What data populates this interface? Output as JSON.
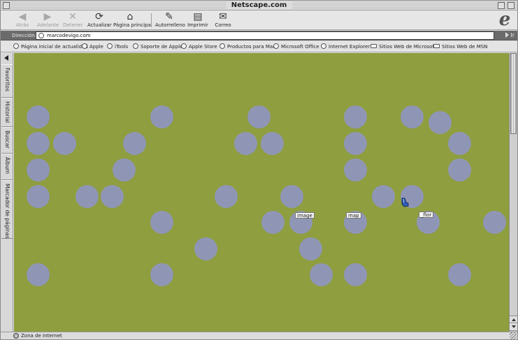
{
  "window": {
    "title": "Netscape.com"
  },
  "toolbar": {
    "back": "Atrás",
    "forward": "Adelante",
    "stop": "Detener",
    "refresh": "Actualizar",
    "home": "Página principal",
    "autofill": "Autorrelleno",
    "print": "Imprimir",
    "mail": "Correo",
    "logo": "e"
  },
  "address": {
    "label": "Dirección:",
    "value": "marcodevigo.com",
    "go": "Ir"
  },
  "favorites": [
    {
      "label": "Página inicial de actualidad",
      "icon": "globe-icon"
    },
    {
      "label": "Apple",
      "icon": "globe-icon"
    },
    {
      "label": "iTools",
      "icon": "globe-icon"
    },
    {
      "label": "Soporte de Apple",
      "icon": "globe-icon"
    },
    {
      "label": "Apple Store",
      "icon": "globe-icon"
    },
    {
      "label": "Productos para Mac",
      "icon": "globe-icon"
    },
    {
      "label": "Microsoft Office",
      "icon": "globe-icon"
    },
    {
      "label": "Internet Explorer",
      "icon": "globe-icon"
    },
    {
      "label": "Sitios Web de Microsoft",
      "icon": "folder-icon"
    },
    {
      "label": "Sitios Web de MSN",
      "icon": "folder-icon"
    }
  ],
  "sidebar": {
    "tabs": [
      "Favoritos",
      "Historial",
      "Buscar",
      "Álbum",
      "Marcador de páginas"
    ]
  },
  "content": {
    "background": "#8f9e3e",
    "dot_color": "#8f96b5",
    "labels": [
      "image",
      "map",
      "_flor"
    ]
  },
  "status": {
    "text": "Zona de Internet"
  }
}
